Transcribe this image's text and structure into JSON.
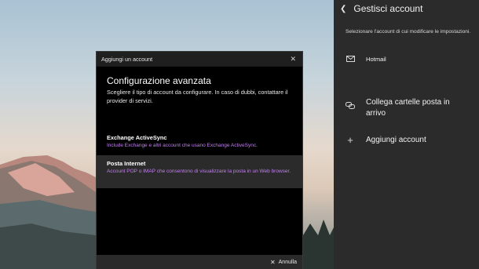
{
  "dialog": {
    "title": "Aggiungi un account",
    "heading": "Configurazione avanzata",
    "description": "Scegliere il tipo di account da configurare. In caso di dubbi, contattare il provider di servizi.",
    "options": [
      {
        "title": "Exchange ActiveSync",
        "subtitle": "Include Exchange e altri account che usano Exchange ActiveSync."
      },
      {
        "title": "Posta Internet",
        "subtitle": "Account POP o IMAP che consentono di visualizzare la posta in un Web browser."
      }
    ],
    "cancel_label": "Annulla"
  },
  "panel": {
    "title": "Gestisci account",
    "hint": "Selezionare l'account di cui modificare le impostazioni.",
    "accounts": [
      {
        "label": "Hotmail",
        "icon": "mail-icon"
      }
    ],
    "actions": [
      {
        "label": "Collega cartelle posta in arrivo",
        "icon": "link-icon"
      },
      {
        "label": "Aggiungi account",
        "icon": "plus-icon"
      }
    ]
  },
  "colors": {
    "accent_purple": "#c27ef0",
    "panel_bg": "#2b2b2b",
    "dialog_bg": "#000000"
  }
}
